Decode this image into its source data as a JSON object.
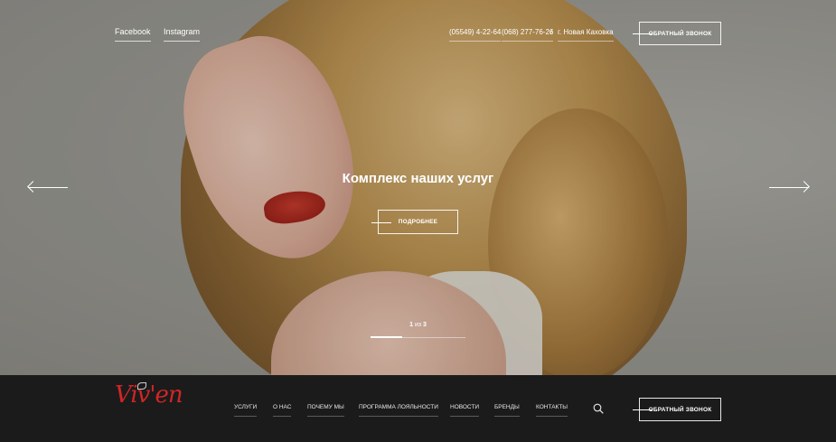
{
  "top_bar": {
    "social_links": [
      "Facebook",
      "Instagram"
    ],
    "phone_1": "(05549) 4-22-64",
    "phone_2": "(068) 277-76-26",
    "separator": "/",
    "city": "г. Новая Каховка",
    "callback_button": "ОБРАТНЫЙ ЗВОНОК"
  },
  "hero": {
    "headline": "Комплекс наших услуг",
    "more_button": "ПОДРОБНЕЕ",
    "slider": {
      "current": "1",
      "of_label": "из",
      "total": "3",
      "progress_fraction": 0.33
    },
    "prev_arrow_icon": "arrow-left-icon",
    "next_arrow_icon": "arrow-right-icon"
  },
  "footer": {
    "logo_text": "Viv'en",
    "brand_color": "#d02626",
    "nav": [
      "УСЛУГИ",
      "О НАС",
      "ПОЧЕМУ МЫ",
      "ПРОГРАММА ЛОЯЛЬНОСТИ",
      "НОВОСТИ",
      "БРЕНДЫ",
      "КОНТАКТЫ"
    ],
    "search_icon": "search-icon",
    "callback_button": "ОБРАТНЫЙ ЗВОНОК"
  }
}
